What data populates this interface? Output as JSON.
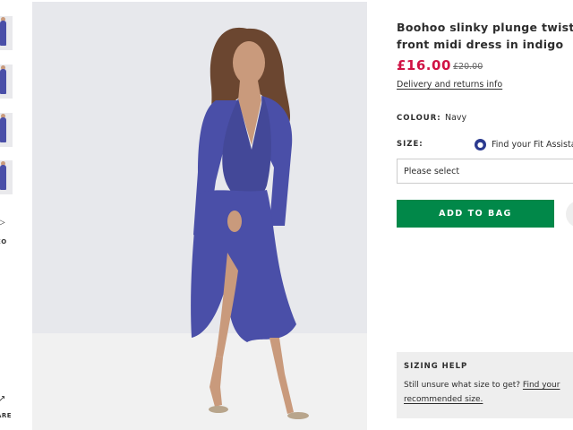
{
  "rail": {
    "video_label": "EO",
    "share_label": "ARE"
  },
  "product": {
    "title": "Boohoo slinky plunge twist front midi dress in indigo",
    "price": "£16.00",
    "was_price": "£20.00",
    "delivery_link": "Delivery and returns info"
  },
  "colour": {
    "label": "COLOUR:",
    "value": "Navy"
  },
  "size": {
    "label": "SIZE:",
    "fit_link": "Find your Fit Assistant",
    "select_placeholder": "Please select"
  },
  "actions": {
    "add_to_bag": "ADD TO BAG"
  },
  "sizing_help": {
    "title": "SIZING HELP",
    "text": "Still unsure what size to get?",
    "link": "Find your recommended size."
  },
  "colors": {
    "price": "#d01345",
    "add_button": "#018849",
    "dress": "#4a4fa8",
    "fit_icon": "#2b3a8f"
  },
  "icons": [
    "play-icon",
    "share-icon",
    "fit-assistant-icon",
    "heart-icon"
  ]
}
